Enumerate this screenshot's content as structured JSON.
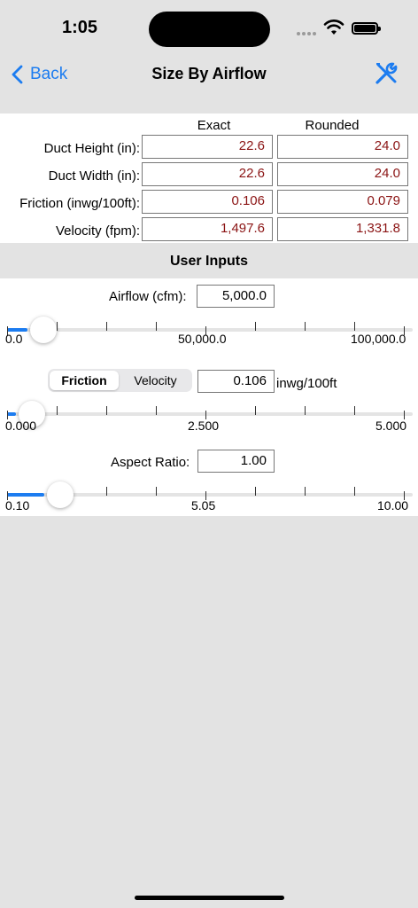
{
  "status": {
    "time": "1:05"
  },
  "nav": {
    "back_label": "Back",
    "title": "Size By Airflow",
    "tools_icon": "tools-icon",
    "accent": "#1c7cf0"
  },
  "results": {
    "exact_header": "Exact",
    "rounded_header": "Rounded",
    "rows": [
      {
        "label": "Duct Height (in):",
        "exact": "22.6",
        "rounded": "24.0"
      },
      {
        "label": "Duct Width (in):",
        "exact": "22.6",
        "rounded": "24.0"
      },
      {
        "label": "Friction (inwg/100ft):",
        "exact": "0.106",
        "rounded": "0.079"
      },
      {
        "label": "Velocity (fpm):",
        "exact": "1,497.6",
        "rounded": "1,331.8"
      }
    ],
    "value_color": "#8b1414"
  },
  "user_inputs": {
    "header": "User Inputs",
    "airflow": {
      "label": "Airflow (cfm):",
      "value": "5,000.0",
      "slider": {
        "min_label": "0.0",
        "mid_label": "50,000.0",
        "max_label": "100,000.0",
        "fraction": 0.05
      }
    },
    "mode": {
      "options": [
        "Friction",
        "Velocity"
      ],
      "selected": "Friction",
      "value": "0.106",
      "unit": "inwg/100ft",
      "slider": {
        "min_label": "0.000",
        "mid_label": "2.500",
        "max_label": "5.000",
        "fraction": 0.021
      }
    },
    "aspect": {
      "label": "Aspect Ratio:",
      "value": "1.00",
      "slider": {
        "min_label": "0.10",
        "mid_label": "5.05",
        "max_label": "10.00",
        "fraction": 0.091
      }
    }
  }
}
